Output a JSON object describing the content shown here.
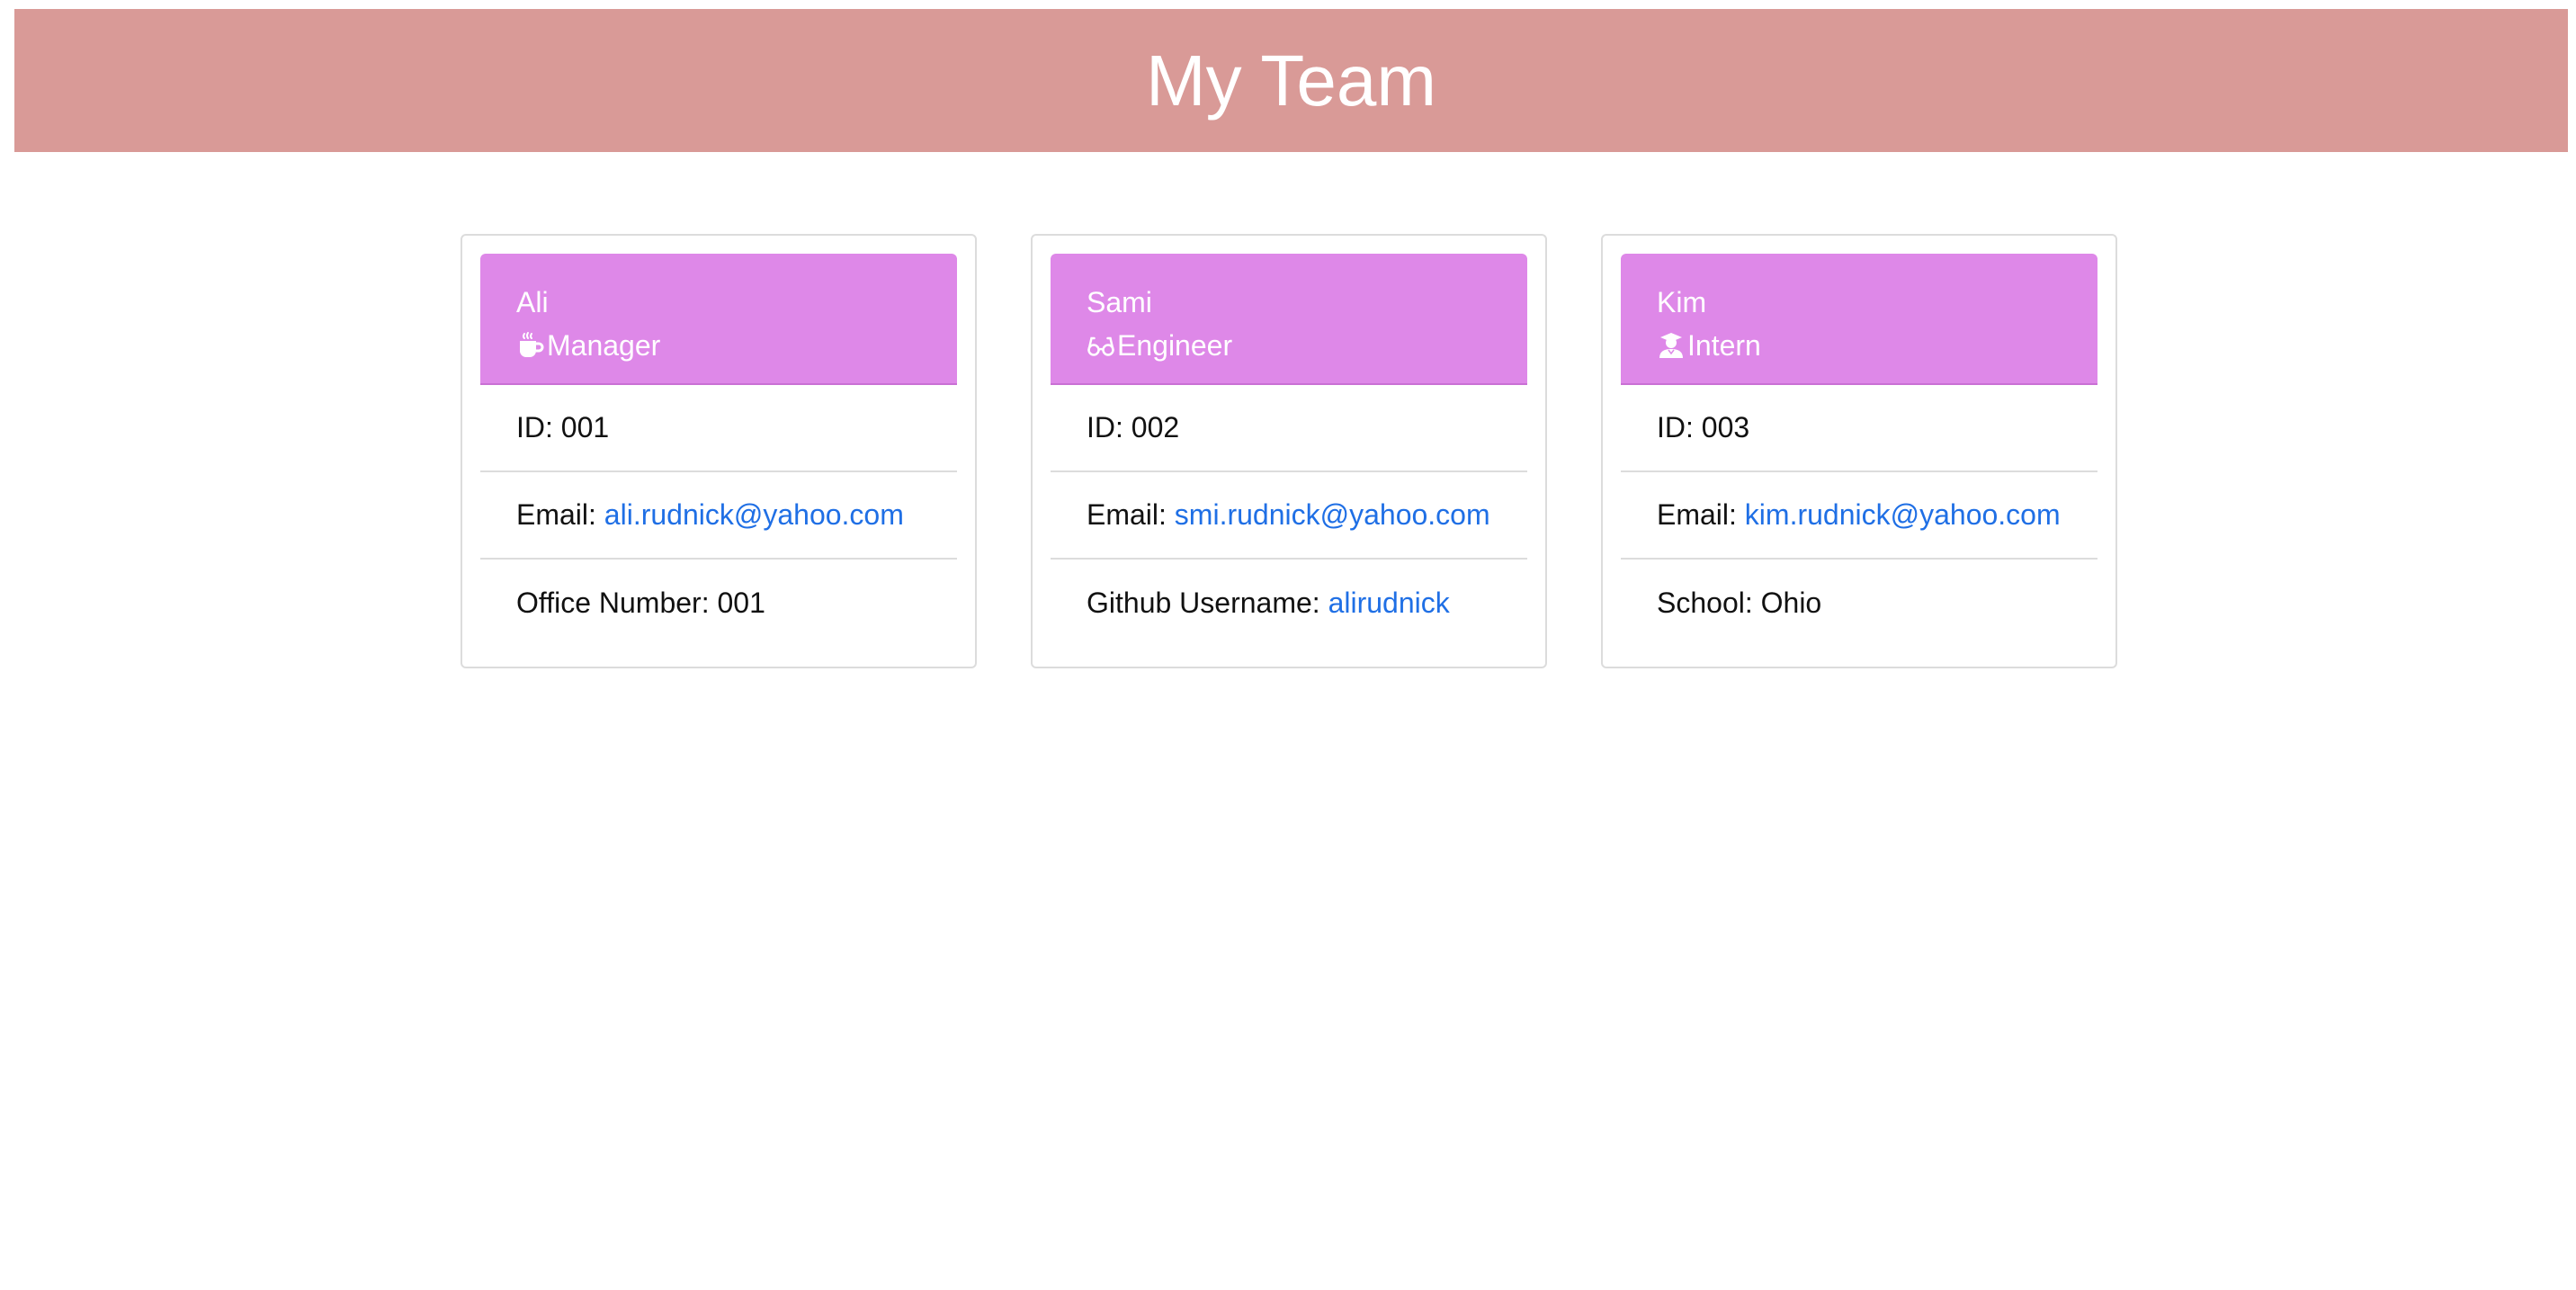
{
  "header": {
    "title": "My Team"
  },
  "colors": {
    "banner": "#d99a97",
    "card_header": "#de88e8",
    "link": "#1f6fe5"
  },
  "employees": [
    {
      "name": "Ali",
      "role": "Manager",
      "icon": "coffee-mug-icon",
      "id_label": "ID: ",
      "id_value": "001",
      "email_label": "Email: ",
      "email": "ali.rudnick@yahoo.com",
      "extra_label": "Office Number: ",
      "extra_value": "001"
    },
    {
      "name": "Sami",
      "role": "Engineer",
      "icon": "glasses-icon",
      "id_label": "ID: ",
      "id_value": "002",
      "email_label": "Email: ",
      "email": "smi.rudnick@yahoo.com",
      "extra_label": "Github Username: ",
      "extra_value": "alirudnick"
    },
    {
      "name": "Kim",
      "role": "Intern",
      "icon": "graduate-icon",
      "id_label": "ID: ",
      "id_value": "003",
      "email_label": "Email: ",
      "email": "kim.rudnick@yahoo.com",
      "extra_label": "School: ",
      "extra_value": "Ohio"
    }
  ]
}
